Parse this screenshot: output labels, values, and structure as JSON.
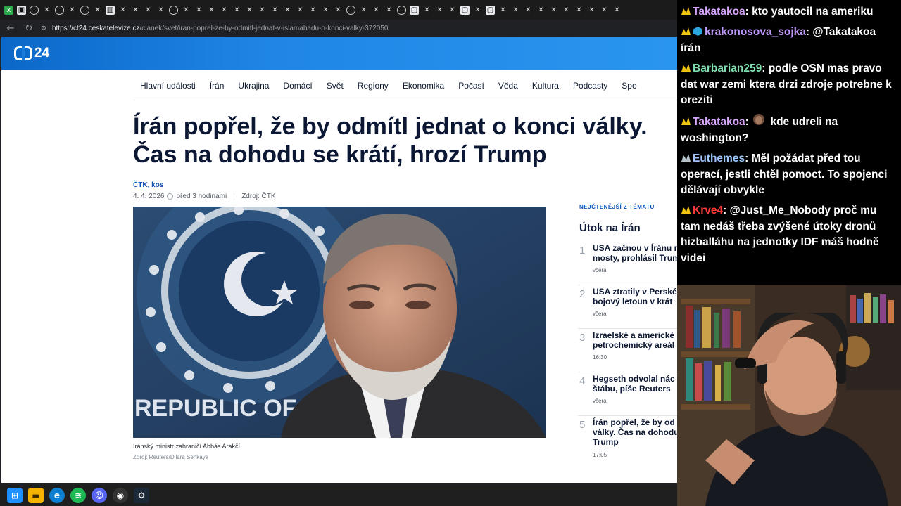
{
  "browser": {
    "url_host": "https://ct24.ceskatelevize.cz",
    "url_path": "/clanek/svet/iran-poprel-ze-by-odmitl-jednat-v-islamabadu-o-konci-valky-372050"
  },
  "site": {
    "logo": "24",
    "nav": [
      "Hlavní události",
      "Írán",
      "Ukrajina",
      "Domácí",
      "Svět",
      "Regiony",
      "Ekonomika",
      "Počasí",
      "Věda",
      "Kultura",
      "Podcasty",
      "Spo"
    ]
  },
  "article": {
    "headline": "Írán popřel, že by odmítl jednat o konci války. Čas na dohodu se krátí, hrozí Trump",
    "authors": "ČTK, kos",
    "date": "4. 4. 2026",
    "relative_time": "před 3 hodinami",
    "source": "Zdroj: ČTK",
    "photo_text": "REPUBLIC OF TÜ",
    "caption": "Íránský ministr zahraničí Abbás Arakčí",
    "credit": "Zdroj: Reuters/Dilara Senkaya"
  },
  "sidebar": {
    "kicker": "NEJČTENĚJŠÍ Z TÉMATU",
    "title": "Útok na Írán",
    "items": [
      {
        "num": "1",
        "text": "USA začnou v Íránu n\nmosty, prohlásil Trum",
        "time": "včera"
      },
      {
        "num": "2",
        "text": "USA ztratily v Perské\nbojový letoun v krát",
        "time": "včera"
      },
      {
        "num": "3",
        "text": "Izraelské a americké\npetrochemický areál",
        "time": "16:30"
      },
      {
        "num": "4",
        "text": "Hegseth odvolal nác\nštábu, píše Reuters",
        "time": "včera"
      },
      {
        "num": "5",
        "text": "Írán popřel, že by od\nválky. Čas na dohodu\nTrump",
        "time": "17:05"
      }
    ]
  },
  "chat": {
    "messages": [
      {
        "user": "Takatakoa",
        "color": "#d8a6ff",
        "text": "kto yautocil na ameriku"
      },
      {
        "user": "krakonosova_sojka",
        "color": "#c09bff",
        "text": "@Takatakoa írán"
      },
      {
        "user": "Barbarian259",
        "color": "#7fe0b0",
        "text": "podle OSN mas pravo dat war zemi ktera drzi zdroje potrebne k oreziti"
      },
      {
        "user": "Takatakoa",
        "color": "#d8a6ff",
        "text": "kde udreli na woshington?"
      },
      {
        "user": "Euthemes",
        "color": "#9ec6ff",
        "text": "Měl požádat před tou operací, jestli chtěl pomoct. To spojenci dělávají obvykle"
      },
      {
        "user": "Krve4",
        "color": "#ff3a3a",
        "text": "@Just_Me_Nobody proč mu tam nedáš třeba zvýšené útoky dronů hizballáhu na jednotky IDF máš hodně videi"
      }
    ]
  }
}
